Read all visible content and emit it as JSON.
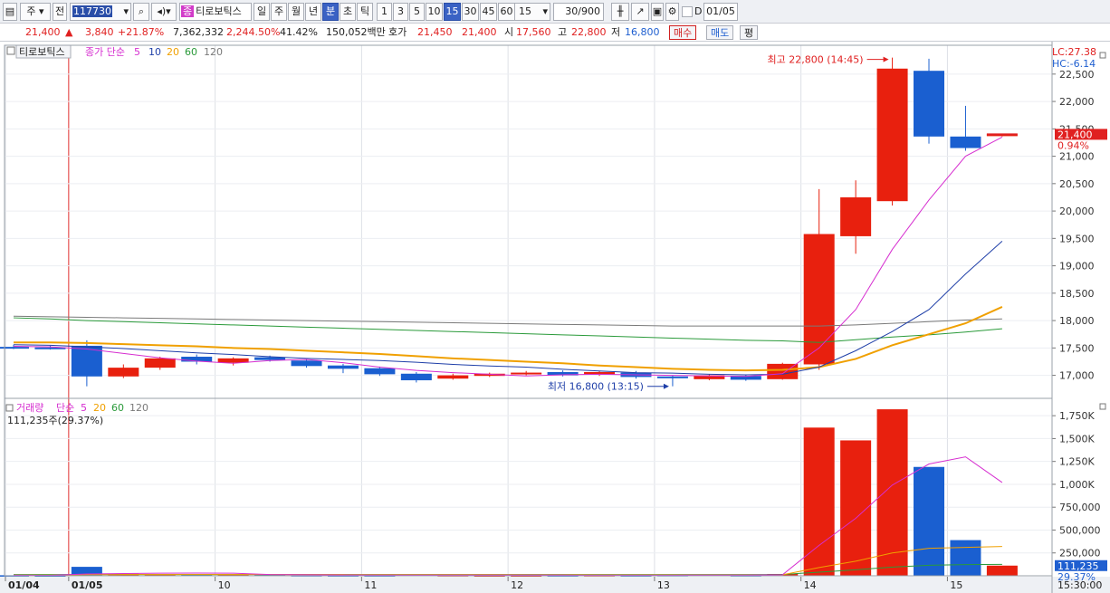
{
  "toolbar": {
    "market": "주",
    "prev_label": "전",
    "code": "117730",
    "stock_name": "티로보틱스",
    "stock_badge": "종",
    "periods": [
      "일",
      "주",
      "월",
      "년",
      "분",
      "초",
      "틱"
    ],
    "minutes": [
      "1",
      "3",
      "5",
      "10",
      "15",
      "30",
      "45",
      "60"
    ],
    "minute_value": "15",
    "count": "30/900",
    "date": "01/05",
    "d_label": "D"
  },
  "quote": {
    "price": "21,400",
    "change": "3,840",
    "change_pct": "+21.87%",
    "volume": "7,362,332",
    "volume_ratio": "2,244.50%",
    "turnover": "41.42%",
    "amount": "150,052백만",
    "hoga_label": "호가",
    "ask": "21,450",
    "bid": "21,400",
    "open_label": "시",
    "open": "17,560",
    "high_label": "고",
    "high": "22,800",
    "low_label": "저",
    "low": "16,800",
    "buy_label": "매수",
    "sell_label": "매도",
    "eval_label": "평"
  },
  "price_chart": {
    "title": "티로보틱스",
    "ma_label": "종가 단순",
    "ma_periods": [
      "5",
      "10",
      "20",
      "60",
      "120"
    ],
    "ma_colors": [
      "#d62ed0",
      "#1f3fa8",
      "#f0a000",
      "#2a9a3a",
      "#7a7a7a"
    ],
    "lc_label": "LC:27.38",
    "hc_label": "HC:-6.14",
    "high_note": "최고 22,800 (14:45)",
    "low_note": "최저 16,800 (13:15)",
    "last_price_tag": "21,400",
    "last_pct_tag": "0.94%",
    "y_ticks": [
      "22,500",
      "22,000",
      "21,500",
      "21,000",
      "20,500",
      "20,000",
      "19,500",
      "19,000",
      "18,500",
      "18,000",
      "17,500",
      "17,000"
    ]
  },
  "volume_chart": {
    "title": "거래량",
    "ma_label": "단순",
    "ma_periods": [
      "5",
      "20",
      "60",
      "120"
    ],
    "current_label": "111,235주(29.37%)",
    "last_vol_tag": "111,235",
    "last_pct_tag": "29.37%",
    "y_ticks": [
      "1,750K",
      "1,500K",
      "1,250K",
      "1,000K",
      "750,000",
      "500,000",
      "250,000"
    ]
  },
  "x_axis": {
    "labels": [
      "01/04",
      "01/05",
      "10",
      "11",
      "12",
      "13",
      "14",
      "15"
    ],
    "time_label": "15:30:00"
  },
  "chart_data": {
    "type": "candlestick",
    "candles": [
      {
        "o": 17520,
        "c": 17500,
        "h": 17560,
        "l": 17480
      },
      {
        "o": 17510,
        "c": 17490,
        "h": 17540,
        "l": 17470
      },
      {
        "o": 17540,
        "c": 16980,
        "h": 17640,
        "l": 16800
      },
      {
        "o": 16980,
        "c": 17140,
        "h": 17200,
        "l": 16950
      },
      {
        "o": 17140,
        "c": 17310,
        "h": 17340,
        "l": 17100
      },
      {
        "o": 17340,
        "c": 17250,
        "h": 17380,
        "l": 17200
      },
      {
        "o": 17230,
        "c": 17310,
        "h": 17330,
        "l": 17180
      },
      {
        "o": 17330,
        "c": 17280,
        "h": 17360,
        "l": 17250
      },
      {
        "o": 17270,
        "c": 17170,
        "h": 17300,
        "l": 17140
      },
      {
        "o": 17180,
        "c": 17120,
        "h": 17210,
        "l": 17040
      },
      {
        "o": 17130,
        "c": 17020,
        "h": 17160,
        "l": 16990
      },
      {
        "o": 17030,
        "c": 16910,
        "h": 17060,
        "l": 16870
      },
      {
        "o": 16940,
        "c": 17000,
        "h": 17030,
        "l": 16920
      },
      {
        "o": 16990,
        "c": 17030,
        "h": 17050,
        "l": 16970
      },
      {
        "o": 17020,
        "c": 17050,
        "h": 17080,
        "l": 17000
      },
      {
        "o": 17060,
        "c": 17000,
        "h": 17090,
        "l": 16980
      },
      {
        "o": 17020,
        "c": 17060,
        "h": 17080,
        "l": 16990
      },
      {
        "o": 17050,
        "c": 16970,
        "h": 17080,
        "l": 16940
      },
      {
        "o": 16980,
        "c": 16950,
        "h": 17000,
        "l": 16800
      },
      {
        "o": 16930,
        "c": 17000,
        "h": 17020,
        "l": 16910
      },
      {
        "o": 16990,
        "c": 16920,
        "h": 17010,
        "l": 16900
      },
      {
        "o": 16930,
        "c": 17210,
        "h": 17230,
        "l": 16920
      },
      {
        "o": 17200,
        "c": 19580,
        "h": 20400,
        "l": 17100
      },
      {
        "o": 19540,
        "c": 20250,
        "h": 20560,
        "l": 19220
      },
      {
        "o": 20180,
        "c": 22600,
        "h": 22800,
        "l": 20100
      },
      {
        "o": 22560,
        "c": 21360,
        "h": 22780,
        "l": 21230
      },
      {
        "o": 21360,
        "c": 21150,
        "h": 21920,
        "l": 21100
      },
      {
        "o": 21380,
        "c": 21400,
        "h": 21400,
        "l": 21360
      }
    ],
    "ma5": [
      17530,
      17520,
      17480,
      17400,
      17320,
      17260,
      17220,
      17270,
      17290,
      17230,
      17150,
      17090,
      17050,
      17020,
      16990,
      17010,
      17020,
      17010,
      17000,
      16990,
      16980,
      17030,
      17500,
      18200,
      19300,
      20200,
      21000,
      21350
    ],
    "ma10": [
      17560,
      17550,
      17520,
      17490,
      17450,
      17410,
      17380,
      17340,
      17310,
      17290,
      17270,
      17240,
      17200,
      17170,
      17150,
      17110,
      17080,
      17050,
      17040,
      17020,
      17010,
      17020,
      17150,
      17450,
      17800,
      18200,
      18850,
      19450
    ],
    "ma20": [
      17600,
      17600,
      17590,
      17570,
      17550,
      17530,
      17500,
      17480,
      17450,
      17420,
      17390,
      17350,
      17310,
      17280,
      17250,
      17220,
      17180,
      17150,
      17120,
      17100,
      17090,
      17100,
      17150,
      17300,
      17550,
      17750,
      17950,
      18250
    ],
    "ma60": [
      18050,
      18030,
      18000,
      17980,
      17960,
      17940,
      17920,
      17900,
      17880,
      17860,
      17840,
      17820,
      17800,
      17780,
      17760,
      17740,
      17720,
      17700,
      17680,
      17660,
      17640,
      17630,
      17600,
      17650,
      17700,
      17740,
      17790,
      17850
    ],
    "ma120": [
      18080,
      18070,
      18060,
      18050,
      18040,
      18030,
      18020,
      18010,
      18000,
      17990,
      17980,
      17970,
      17960,
      17950,
      17940,
      17930,
      17920,
      17910,
      17900,
      17900,
      17900,
      17900,
      17900,
      17920,
      17950,
      17980,
      18010,
      18030
    ],
    "volume": [
      6000,
      3000,
      98000,
      22000,
      16000,
      13000,
      12000,
      10000,
      7000,
      6000,
      6000,
      12000,
      7000,
      5000,
      5000,
      6000,
      7000,
      6000,
      8000,
      14000,
      7000,
      20000,
      1620000,
      1480000,
      1820000,
      1190000,
      390000,
      111235
    ],
    "vol_ma5": [
      6000,
      5000,
      20000,
      25000,
      29000,
      30000,
      28000,
      14000,
      11000,
      9000,
      8000,
      8000,
      8000,
      7000,
      7000,
      7000,
      6000,
      6000,
      6000,
      8000,
      8000,
      11000,
      333000,
      628000,
      992000,
      1222000,
      1300000,
      1020000
    ],
    "vol_ma20": [
      8000,
      8000,
      12000,
      13000,
      13000,
      13000,
      13000,
      13000,
      13000,
      13000,
      12000,
      12000,
      12000,
      12000,
      11000,
      11000,
      10000,
      10000,
      10000,
      10000,
      10000,
      11000,
      90000,
      160000,
      250000,
      300000,
      310000,
      320000
    ],
    "vol_ma60": [
      14000,
      14000,
      14000,
      14000,
      14000,
      14000,
      14000,
      14000,
      14000,
      14000,
      14000,
      14000,
      14000,
      14000,
      14000,
      14000,
      14000,
      14000,
      14000,
      14000,
      14000,
      14000,
      40000,
      65000,
      95000,
      115000,
      122000,
      125000
    ],
    "ylim": [
      16580,
      22960
    ],
    "vol_ylim": [
      0,
      1900000
    ]
  }
}
